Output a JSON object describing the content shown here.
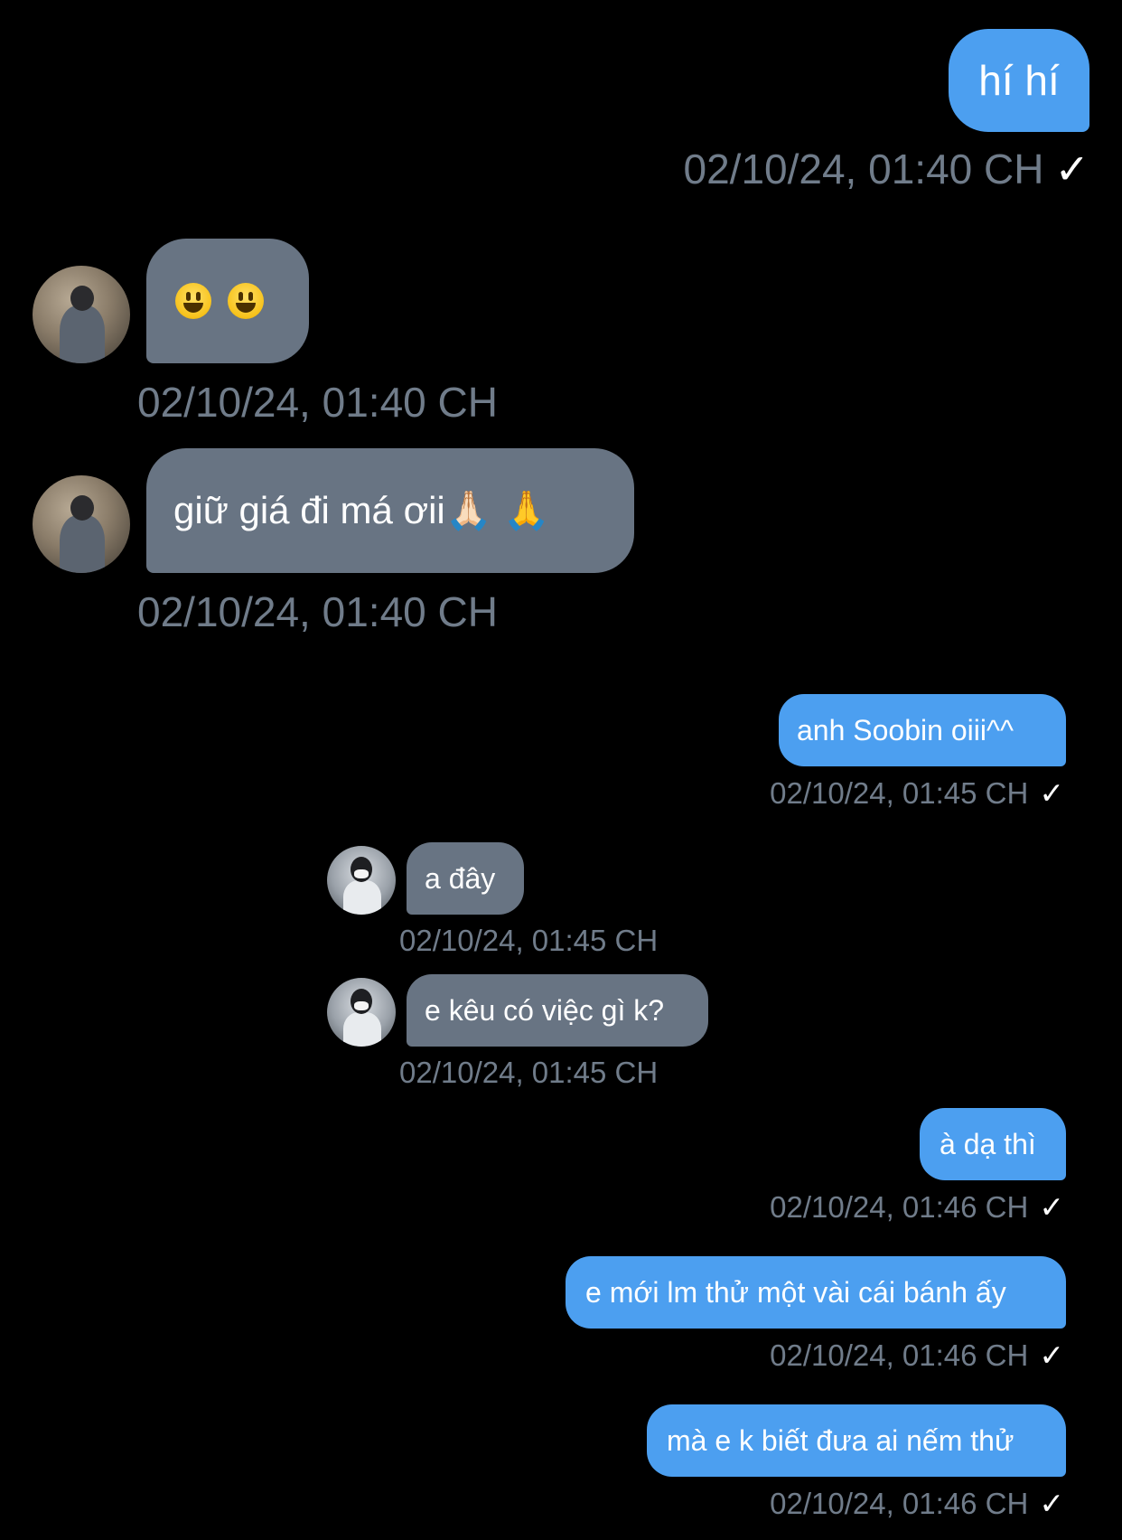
{
  "messages": [
    {
      "id": 1,
      "side": "sent",
      "text": "hí hí",
      "time": "02/10/24, 01:40 CH",
      "read_check": "✓"
    },
    {
      "id": 2,
      "side": "received",
      "text": "😃 😃",
      "time": "02/10/24, 01:40 CH",
      "avatar": "user-avatar-photo"
    },
    {
      "id": 3,
      "side": "received",
      "text": "giữ giá đi má ơii🙏🏻 🙏",
      "time": "02/10/24, 01:40 CH",
      "avatar": "user-avatar-photo"
    },
    {
      "id": 4,
      "side": "sent",
      "text": "anh Soobin oiii^^",
      "time": "02/10/24, 01:45 CH",
      "read_check": "✓"
    },
    {
      "id": 5,
      "side": "received",
      "text": "a đây",
      "time": "02/10/24, 01:45 CH",
      "avatar": "user-avatar-photo"
    },
    {
      "id": 6,
      "side": "received",
      "text": "e kêu có việc gì k?",
      "time": "02/10/24, 01:45 CH",
      "avatar": "user-avatar-photo"
    },
    {
      "id": 7,
      "side": "sent",
      "text": "à dạ thì",
      "time": "02/10/24, 01:46 CH",
      "read_check": "✓"
    },
    {
      "id": 8,
      "side": "sent",
      "text": "e mới lm thử một vài cái bánh ấy",
      "time": "02/10/24, 01:46 CH",
      "read_check": "✓"
    },
    {
      "id": 9,
      "side": "sent",
      "text": "mà e k biết đưa ai nếm thử",
      "time": "02/10/24, 01:46 CH",
      "read_check": "✓"
    }
  ],
  "colors": {
    "background": "#000000",
    "sent_bubble": "#4c9ff0",
    "received_bubble": "#687483",
    "timestamp": "#707c8a"
  }
}
